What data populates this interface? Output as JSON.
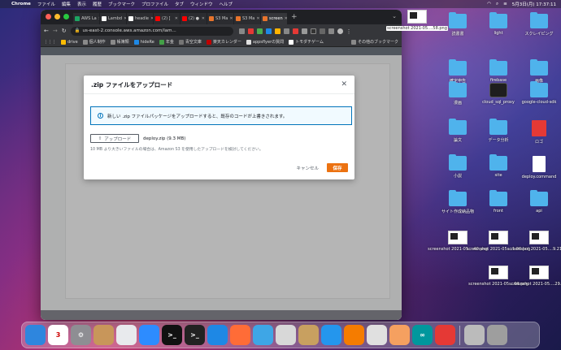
{
  "menubar": {
    "app_name": "Chrome",
    "items": [
      "ファイル",
      "編集",
      "表示",
      "履歴",
      "ブックマーク",
      "プロファイル",
      "タブ",
      "ウィンドウ",
      "ヘルプ"
    ],
    "clock": "5月3日(月)  17:37:11"
  },
  "browser": {
    "tabs": [
      {
        "label": "AWS La",
        "color": "#1da462"
      },
      {
        "label": "Lambd",
        "color": "#ffffff"
      },
      {
        "label": "headle",
        "color": "#ffffff"
      },
      {
        "label": "(2) [",
        "color": "#ff0000"
      },
      {
        "label": "(2) ●",
        "color": "#ff0000"
      },
      {
        "label": "S3 Ma",
        "color": "#e8742c"
      },
      {
        "label": "S3 Ma",
        "color": "#e8742c"
      },
      {
        "label": "screen",
        "color": "#e8742c"
      }
    ],
    "url": "us-east-2.console.aws.amazon.com/lam...",
    "bookmarks": [
      "drive",
      "個人制作",
      "帳簿類",
      "hideRe",
      "年金",
      "青空文庫",
      "楽天カレンダー",
      "appsflyerの質問",
      "トモダチゲーム"
    ],
    "other_bookmarks": "その他のブックマーク"
  },
  "modal": {
    "title": ".zip ファイルをアップロード",
    "info_text": "新しい .zip ファイルパッケージをアップロードすると、既存のコードが上書きされます。",
    "upload_label": "アップロード",
    "file_name": "deploy.zip (9.3 MB)",
    "hint": "10 MB より大きいファイルの場合は、Amazon S3 を使用したアップロードを検討してください。",
    "cancel_label": "キャンセル",
    "save_label": "保存"
  },
  "desktop": {
    "icons": [
      {
        "label": "screenshot 2021-05....58.png",
        "kind": "thumb",
        "selected": true
      },
      {
        "label": "読書書",
        "kind": "folder"
      },
      {
        "label": "light",
        "kind": "folder"
      },
      {
        "label": "スクレイピング",
        "kind": "folder"
      },
      {
        "label": "確定申告",
        "kind": "folder"
      },
      {
        "label": "firebase",
        "kind": "folder"
      },
      {
        "label": "画像",
        "kind": "folder"
      },
      {
        "label": "漫画",
        "kind": "folder"
      },
      {
        "label": "cloud_sql_proxy",
        "kind": "term"
      },
      {
        "label": "google-cloud-sdk",
        "kind": "folder"
      },
      {
        "label": "論文",
        "kind": "folder"
      },
      {
        "label": "データ分析",
        "kind": "folder"
      },
      {
        "label": "ロゴ",
        "kind": "pdf"
      },
      {
        "label": "小説",
        "kind": "folder"
      },
      {
        "label": "site",
        "kind": "folder"
      },
      {
        "label": "deploy.command",
        "kind": "doc"
      },
      {
        "label": "サイト作成納品物",
        "kind": "folder"
      },
      {
        "label": "front",
        "kind": "folder"
      },
      {
        "label": "api",
        "kind": "folder"
      },
      {
        "label": "screenshot 2021-05....40.png",
        "kind": "thumb"
      },
      {
        "label": "screenshot 2021-05....1.00.png",
        "kind": "thumb"
      },
      {
        "label": "screenshot 2021-05....9.21.png",
        "kind": "thumb"
      },
      {
        "label": "screenshot 2021-05....06.png",
        "kind": "thumb"
      },
      {
        "label": "screenshot 2021-05....29.png",
        "kind": "thumb"
      }
    ]
  },
  "dock": {
    "apps": [
      {
        "name": "finder",
        "color": "#2e86de",
        "glyph": ""
      },
      {
        "name": "calendar",
        "color": "#ffffff",
        "glyph": "3"
      },
      {
        "name": "system-preferences",
        "color": "#8e8e93",
        "glyph": "⚙"
      },
      {
        "name": "contacts",
        "color": "#c8965a",
        "glyph": ""
      },
      {
        "name": "chrome",
        "color": "#e8eaed",
        "glyph": ""
      },
      {
        "name": "zoom",
        "color": "#2d8cff",
        "glyph": ""
      },
      {
        "name": "terminal-1",
        "color": "#111111",
        "glyph": ">_"
      },
      {
        "name": "terminal-2",
        "color": "#222222",
        "glyph": ">_"
      },
      {
        "name": "vscode",
        "color": "#1e88e5",
        "glyph": ""
      },
      {
        "name": "postman",
        "color": "#ff6c37",
        "glyph": ""
      },
      {
        "name": "quicktime",
        "color": "#3ea6e6",
        "glyph": ""
      },
      {
        "name": "sequel",
        "color": "#d8d8d8",
        "glyph": ""
      },
      {
        "name": "package",
        "color": "#c8a060",
        "glyph": ""
      },
      {
        "name": "docker",
        "color": "#2496ed",
        "glyph": ""
      },
      {
        "name": "sourcetree",
        "color": "#f57c00",
        "glyph": ""
      },
      {
        "name": "steam",
        "color": "#e0e0e0",
        "glyph": ""
      },
      {
        "name": "app-orange",
        "color": "#f5a060",
        "glyph": ""
      },
      {
        "name": "arduino",
        "color": "#00979d",
        "glyph": "∞"
      },
      {
        "name": "clock",
        "color": "#e53935",
        "glyph": ""
      },
      {
        "name": "preview",
        "color": "#bbbbbb",
        "glyph": ""
      },
      {
        "name": "trash",
        "color": "#9e9e9e",
        "glyph": ""
      }
    ]
  }
}
